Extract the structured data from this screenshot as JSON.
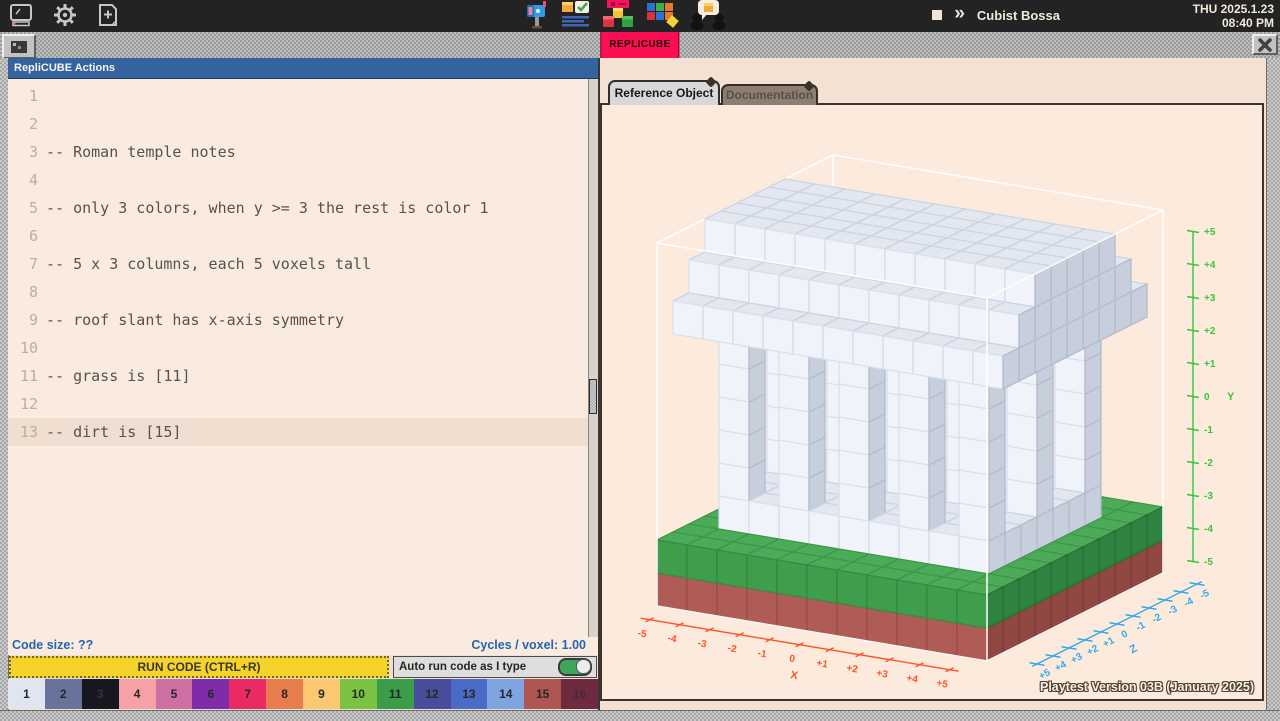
{
  "system_bar": {
    "icons_left": [
      "computer-icon",
      "settings-icon",
      "new-file-icon"
    ],
    "icons_center": [
      "mailbox-icon",
      "tasks-icon",
      "replicube-logo-icon",
      "puzzles-icon",
      "community-icon"
    ],
    "music": {
      "stop_icon": "stop-icon",
      "next_glyph": "»",
      "track_title": "Cubist Bossa"
    },
    "date": "THU 2025.1.23",
    "time": "08:40 PM"
  },
  "window": {
    "tab_label": "REPLICUBE",
    "close_icon": "close-icon"
  },
  "editor": {
    "title": "RepliCUBE Actions",
    "current_line": 13,
    "lines": [
      "",
      "",
      "-- Roman temple notes",
      "",
      "-- only 3 colors, when y >= 3 the rest is color 1",
      "",
      "-- 5 x 3 columns, each 5 voxels tall",
      "",
      "-- roof slant has x-axis symmetry",
      "",
      "-- grass is [11]",
      "",
      "-- dirt is [15]"
    ],
    "status_left": "Code size: ??",
    "status_right": "Cycles / voxel: 1.00",
    "run_button_label": "RUN CODE (CTRL+R)",
    "auto_run_label": "Auto run code as I type",
    "auto_run_enabled": true,
    "palette": [
      {
        "n": "1",
        "color": "#DFE6F1"
      },
      {
        "n": "2",
        "color": "#67739B"
      },
      {
        "n": "3",
        "color": "#17171F",
        "text": "#34343C"
      },
      {
        "n": "4",
        "color": "#F5A1A5"
      },
      {
        "n": "5",
        "color": "#CE6FA4"
      },
      {
        "n": "6",
        "color": "#7E2CA8"
      },
      {
        "n": "7",
        "color": "#EA2A62"
      },
      {
        "n": "8",
        "color": "#E77C4C"
      },
      {
        "n": "9",
        "color": "#F9C871"
      },
      {
        "n": "10",
        "color": "#7CC242"
      },
      {
        "n": "11",
        "color": "#3B9C4A"
      },
      {
        "n": "12",
        "color": "#474D9B"
      },
      {
        "n": "13",
        "color": "#4A6CC8"
      },
      {
        "n": "14",
        "color": "#80A4DF"
      },
      {
        "n": "15",
        "color": "#AE5752"
      },
      {
        "n": "16",
        "color": "#6E2B40",
        "text": "#4A2833"
      }
    ]
  },
  "reference": {
    "tabs": [
      {
        "label": "Reference Object",
        "active": true
      },
      {
        "label": "Documentation",
        "active": false
      }
    ],
    "version_text": "Playtest Version 03B (January 2025)",
    "wireframe_color": "#FFFFFF",
    "axes": {
      "x": {
        "label": "X",
        "color": "#FB5428",
        "ticks": [
          "-5",
          "-4",
          "-3",
          "-2",
          "-1",
          "0",
          "+1",
          "+2",
          "+3",
          "+4",
          "+5"
        ]
      },
      "y": {
        "label": "Y",
        "color": "#38C63B",
        "ticks": [
          "-5",
          "-4",
          "-3",
          "-2",
          "-1",
          "0",
          "+1",
          "+2",
          "+3",
          "+4",
          "+5"
        ]
      },
      "z": {
        "label": "Z",
        "color": "#35AAE8",
        "ticks": [
          "-5",
          "-4",
          "-3",
          "-2",
          "-1",
          "0",
          "+1",
          "+2",
          "+3",
          "+4",
          "+5"
        ]
      }
    },
    "model": {
      "colors": {
        "stone": {
          "top": "#E2E7F0",
          "front": "#F0F3F9",
          "side": "#C7CEDC",
          "top_s": "#CDD4E2",
          "front_s": "#DBE0EB",
          "side_s": "#B4BCCD"
        },
        "grass": {
          "top": "#4BAB58",
          "front": "#3F9D4C",
          "side": "#2E8340",
          "top_s": "#3F994C",
          "front_s": "#358B42",
          "side_s": "#276F36"
        },
        "dirt": {
          "top": "#BA6963",
          "front": "#B05C56",
          "side": "#8F4741",
          "top_s": "#A75A54",
          "front_s": "#9D4F49",
          "side_s": "#7C3B36"
        }
      },
      "regions": [
        {
          "color": "dirt",
          "x": [
            -5,
            5
          ],
          "y": [
            -5,
            -5
          ],
          "z": [
            -5,
            5
          ]
        },
        {
          "color": "grass",
          "x": [
            -5,
            5
          ],
          "y": [
            -4,
            -4
          ],
          "z": [
            -5,
            5
          ]
        },
        {
          "color": "stone",
          "x": [
            -4,
            4
          ],
          "y": [
            -3,
            -3
          ],
          "z": [
            -3,
            3
          ]
        },
        {
          "color": "stone",
          "x": [
            -5,
            5
          ],
          "y": [
            3,
            3
          ],
          "z": [
            -4,
            4
          ]
        },
        {
          "color": "stone",
          "x": [
            -5,
            5
          ],
          "y": [
            4,
            4
          ],
          "z": [
            -3,
            3
          ]
        },
        {
          "color": "stone",
          "x": [
            -5,
            5
          ],
          "y": [
            5,
            5
          ],
          "z": [
            -2,
            2
          ]
        }
      ],
      "columns": {
        "color": "stone",
        "xs": [
          -4,
          -2,
          0,
          2,
          4
        ],
        "zs": [
          -3,
          0,
          3
        ],
        "y": [
          -2,
          2
        ]
      }
    }
  }
}
